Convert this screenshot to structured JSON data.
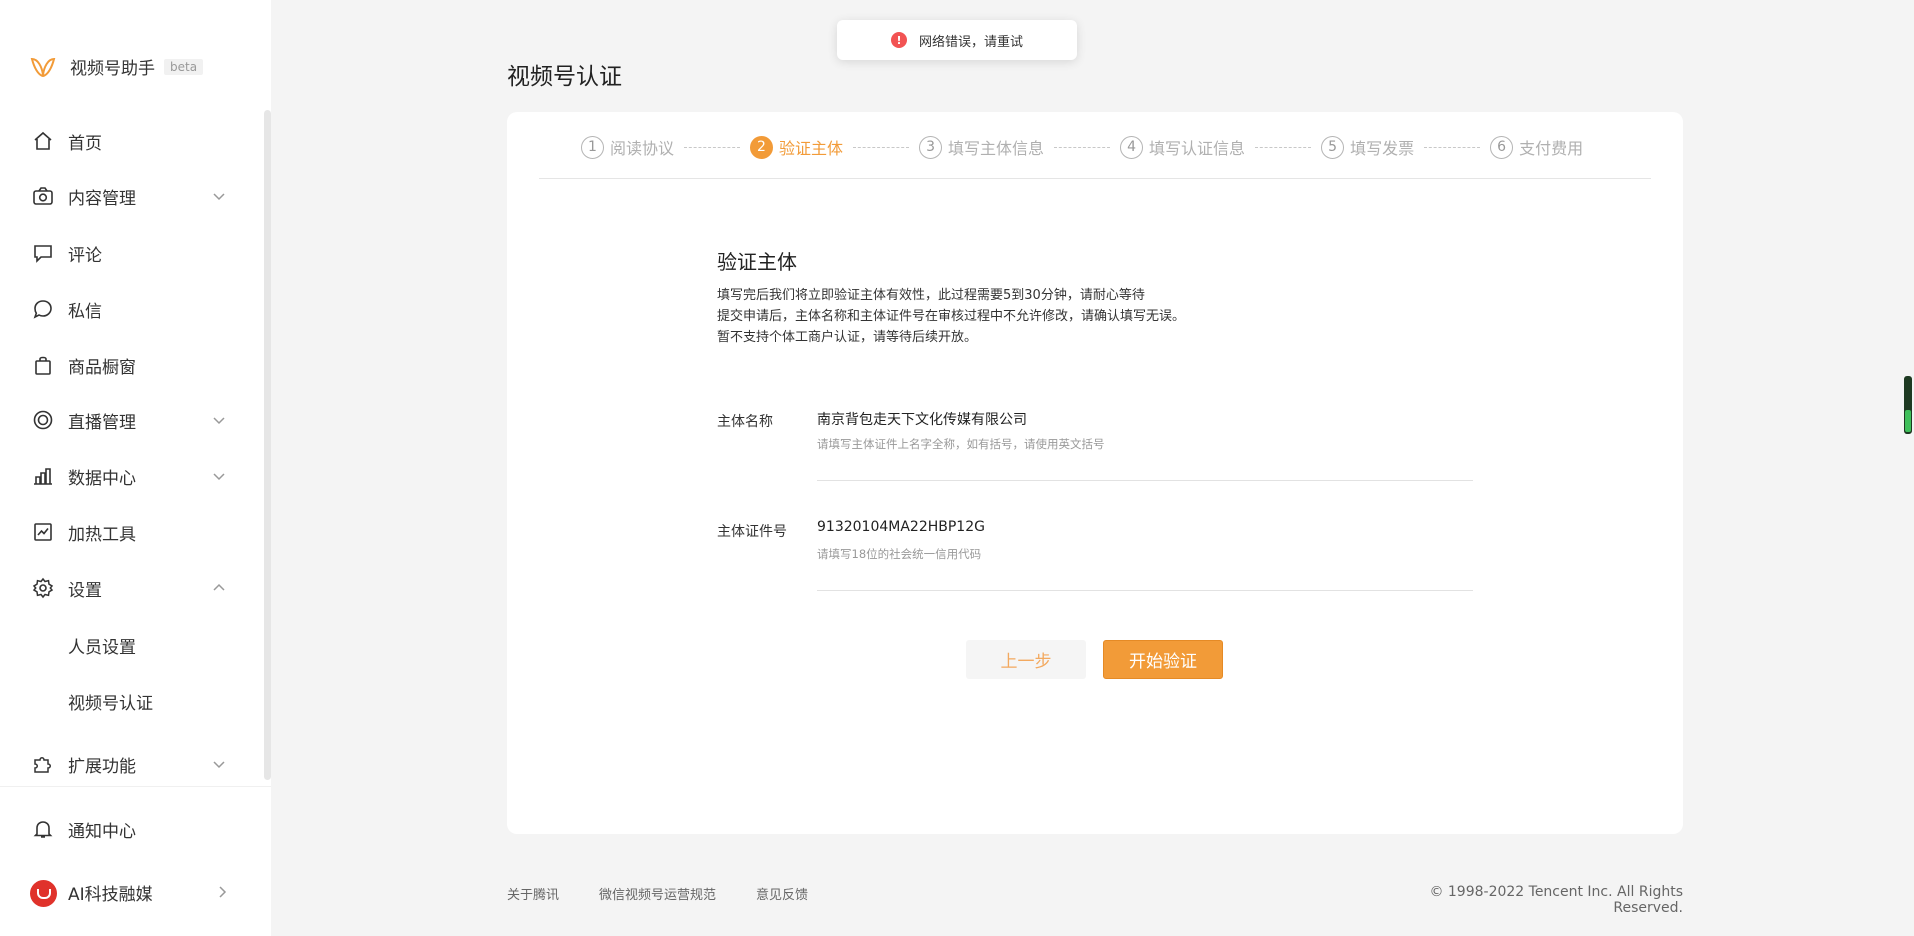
{
  "brand": {
    "name": "视频号助手",
    "badge": "beta",
    "accent": "#f29b38"
  },
  "sidebar": {
    "items": [
      {
        "label": "首页",
        "icon": "home-icon"
      },
      {
        "label": "内容管理",
        "icon": "camera-icon",
        "expandable": true,
        "expanded": false
      },
      {
        "label": "评论",
        "icon": "comment-icon"
      },
      {
        "label": "私信",
        "icon": "message-icon"
      },
      {
        "label": "商品橱窗",
        "icon": "shopping-bag-icon"
      },
      {
        "label": "直播管理",
        "icon": "live-icon",
        "expandable": true,
        "expanded": false
      },
      {
        "label": "数据中心",
        "icon": "bar-chart-icon",
        "expandable": true,
        "expanded": false
      },
      {
        "label": "加热工具",
        "icon": "trend-icon"
      },
      {
        "label": "设置",
        "icon": "gear-icon",
        "expandable": true,
        "expanded": true
      },
      {
        "label": "人员设置"
      },
      {
        "label": "视频号认证"
      },
      {
        "label": "扩展功能",
        "icon": "puzzle-icon",
        "expandable": true,
        "expanded": false
      }
    ],
    "notification": {
      "label": "通知中心",
      "icon": "bell-icon"
    },
    "account": {
      "label": "AI科技融媒"
    }
  },
  "toast": {
    "text": "网络错误，请重试",
    "color": "#f25353"
  },
  "page": {
    "title": "视频号认证"
  },
  "steps": [
    {
      "num": "1",
      "label": "阅读协议"
    },
    {
      "num": "2",
      "label": "验证主体",
      "active": true
    },
    {
      "num": "3",
      "label": "填写主体信息"
    },
    {
      "num": "4",
      "label": "填写认证信息"
    },
    {
      "num": "5",
      "label": "填写发票"
    },
    {
      "num": "6",
      "label": "支付费用"
    }
  ],
  "section": {
    "title": "验证主体",
    "desc": [
      "填写完后我们将立即验证主体有效性，此过程需要5到30分钟，请耐心等待",
      "提交申请后，主体名称和主体证件号在审核过程中不允许修改，请确认填写无误。",
      "暂不支持个体工商户认证，请等待后续开放。"
    ]
  },
  "form": {
    "name": {
      "label": "主体名称",
      "value": "南京背包走天下文化传媒有限公司",
      "hint": "请填写主体证件上名字全称，如有括号，请使用英文括号"
    },
    "id": {
      "label": "主体证件号",
      "value": "91320104MA22HBP12G",
      "hint": "请填写18位的社会统一信用代码"
    }
  },
  "buttons": {
    "prev": "上一步",
    "start": "开始验证"
  },
  "footer": {
    "links": [
      "关于腾讯",
      "微信视频号运营规范",
      "意见反馈"
    ],
    "copyright": "© 1998-2022 Tencent Inc. All Rights Reserved."
  }
}
